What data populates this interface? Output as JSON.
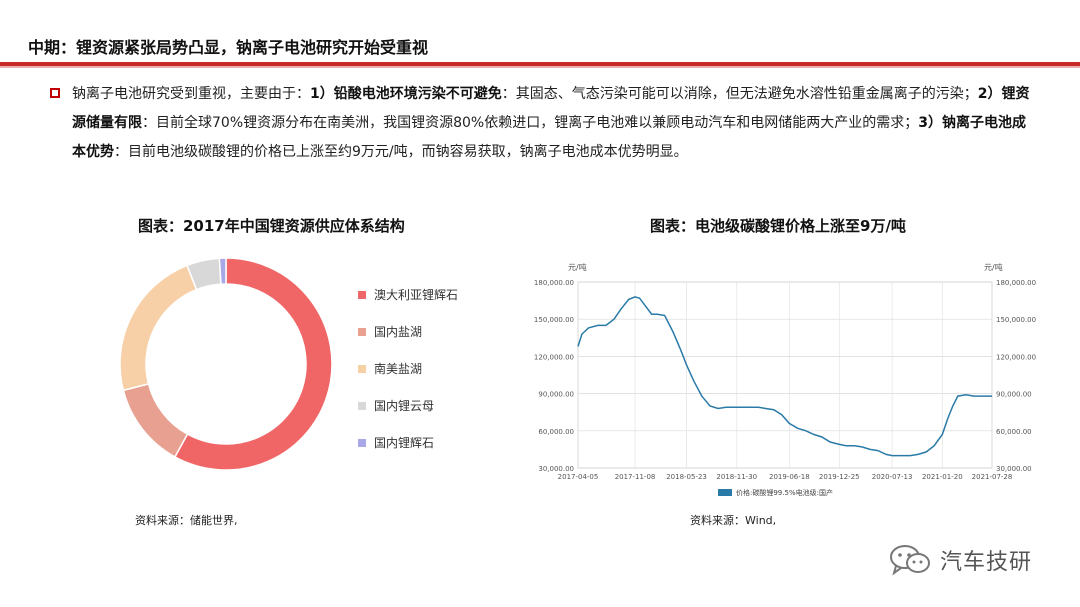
{
  "header": {
    "title": "中期：锂资源紧张局势凸显，钠离子电池研究开始受重视",
    "accent_color": "#c82828"
  },
  "paragraph": {
    "p1": "钠离子电池研究受到重视，主要由于：",
    "b1": "1）铅酸电池环境污染不可避免",
    "p2": "：其固态、气态污染可能可以消除，但无法避免水溶性铅重金属离子的污染；",
    "b2": "2）锂资源储量有限",
    "p3": "：目前全球70%锂资源分布在南美洲，我国锂资源80%依赖进口，锂离子电池难以兼顾电动汽车和电网储能两大产业的需求；",
    "b3": "3）钠离子电池成本优势",
    "p4": "：目前电池级碳酸锂的价格已上涨至约9万元/吨，而钠容易获取，钠离子电池成本优势明显。"
  },
  "left_chart": {
    "title": "图表：2017年中国锂资源供应体系结构",
    "source": "资料来源：储能世界,"
  },
  "right_chart": {
    "title": "图表：电池级碳酸锂价格上涨至9万/吨",
    "source": "资料来源：Wind,",
    "unit_left": "元/吨",
    "unit_right": "元/吨"
  },
  "watermark": {
    "text": "汽车技研",
    "icon": "wechat-icon"
  },
  "chart_data": [
    {
      "type": "pie",
      "variant": "donut",
      "title": "图表：2017年中国锂资源供应体系结构",
      "legend_position": "right",
      "categories": [
        "澳大利亚锂辉石",
        "国内盐湖",
        "南美盐湖",
        "国内锂云母",
        "国内锂辉石"
      ],
      "values": [
        58,
        13,
        23,
        5,
        1
      ],
      "colors": [
        "#f06666",
        "#e8a090",
        "#f8d0a8",
        "#d8d8d8",
        "#a8a8e8"
      ]
    },
    {
      "type": "line",
      "title": "图表：电池级碳酸锂价格上涨至9万/吨",
      "ylabel": "元/吨",
      "ylim": [
        30000,
        180000
      ],
      "yticks": [
        "30,000.00",
        "60,000.00",
        "90,000.00",
        "120,000.00",
        "150,000.00",
        "180,000.00"
      ],
      "xticks": [
        "2017-04-05",
        "2017-11-08",
        "2018-05-23",
        "2018-11-30",
        "2019-06-18",
        "2019-12-25",
        "2020-07-13",
        "2021-01-20",
        "2021-07-28"
      ],
      "grid": true,
      "legend_position": "bottom",
      "series": [
        {
          "name": "价格:碳酸锂99.5%电池级:国产",
          "color": "#2a7aa8",
          "x": [
            "2017-04-05",
            "2017-04-20",
            "2017-05-15",
            "2017-06-20",
            "2017-07-20",
            "2017-08-20",
            "2017-09-15",
            "2017-10-15",
            "2017-11-08",
            "2017-11-25",
            "2017-12-20",
            "2018-01-10",
            "2018-02-01",
            "2018-03-01",
            "2018-04-01",
            "2018-05-01",
            "2018-05-23",
            "2018-06-20",
            "2018-07-20",
            "2018-08-20",
            "2018-09-20",
            "2018-10-20",
            "2018-11-30",
            "2019-01-10",
            "2019-02-20",
            "2019-03-20",
            "2019-04-20",
            "2019-05-20",
            "2019-06-18",
            "2019-07-20",
            "2019-08-20",
            "2019-09-20",
            "2019-10-20",
            "2019-11-20",
            "2019-12-25",
            "2020-01-20",
            "2020-02-20",
            "2020-03-20",
            "2020-04-20",
            "2020-05-20",
            "2020-06-20",
            "2020-07-13",
            "2020-08-20",
            "2020-09-20",
            "2020-10-20",
            "2020-11-20",
            "2020-12-20",
            "2021-01-20",
            "2021-02-10",
            "2021-03-01",
            "2021-03-20",
            "2021-04-20",
            "2021-05-20",
            "2021-06-20",
            "2021-07-28"
          ],
          "values": [
            128000,
            138000,
            143000,
            145000,
            145000,
            150000,
            158000,
            166000,
            168000,
            167000,
            160000,
            154000,
            154000,
            153000,
            140000,
            125000,
            113000,
            100000,
            88000,
            80000,
            78000,
            79000,
            79000,
            79000,
            79000,
            78000,
            77000,
            73000,
            66000,
            62000,
            60000,
            57000,
            55000,
            51000,
            49000,
            48000,
            48000,
            47000,
            45000,
            44000,
            41000,
            40000,
            40000,
            40000,
            41000,
            43000,
            48000,
            57000,
            70000,
            80000,
            88000,
            89000,
            88000,
            88000,
            88000
          ]
        }
      ]
    }
  ]
}
